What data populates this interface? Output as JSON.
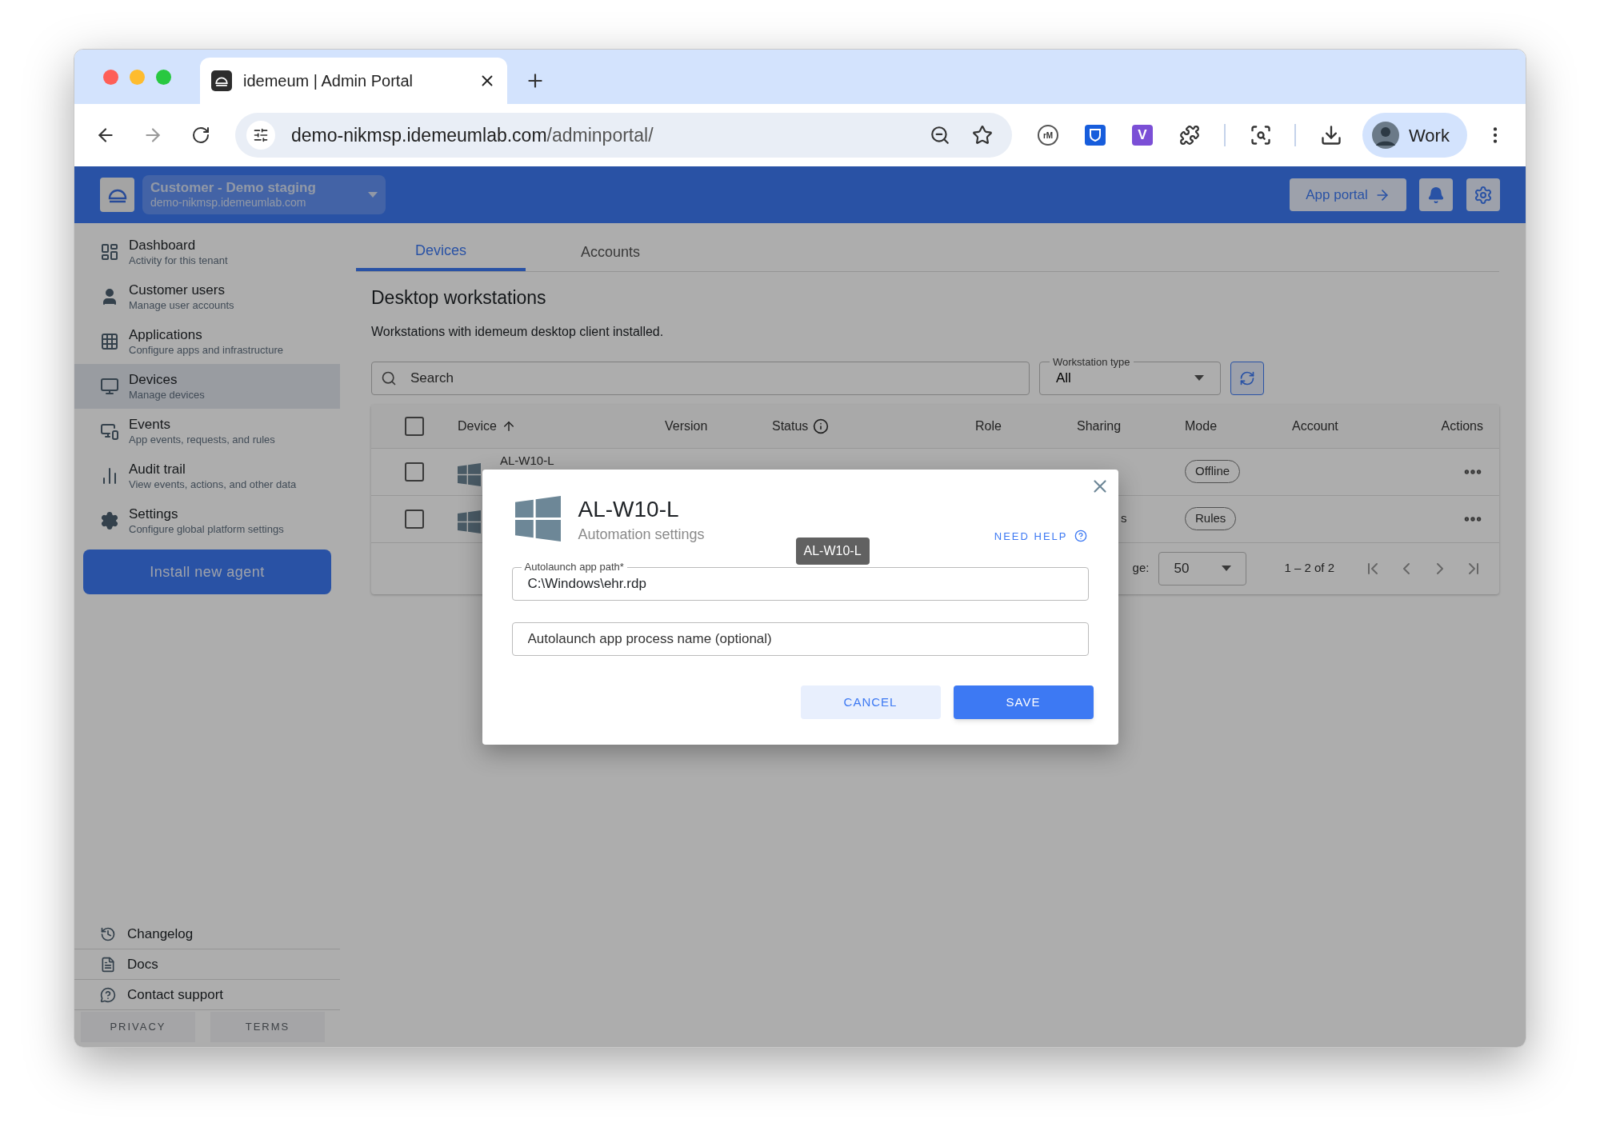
{
  "browser": {
    "tab_title": "idemeum | Admin Portal",
    "url_host": "demo-nikmsp.idemeumlab.com",
    "url_path": "/adminportal/",
    "profile": "Work",
    "extensions": [
      {
        "kind": "circle",
        "label": "rM"
      },
      {
        "kind": "shield"
      },
      {
        "kind": "letter",
        "label": "V"
      },
      {
        "kind": "puzzle"
      }
    ]
  },
  "header": {
    "tenant_name": "Customer - Demo staging",
    "tenant_domain": "demo-nikmsp.idemeumlab.com",
    "app_portal": "App portal"
  },
  "sidebar": {
    "items": [
      {
        "title": "Dashboard",
        "subtitle": "Activity for this tenant",
        "selected": false
      },
      {
        "title": "Customer users",
        "subtitle": "Manage user accounts",
        "selected": false
      },
      {
        "title": "Applications",
        "subtitle": "Configure apps and infrastructure",
        "selected": false
      },
      {
        "title": "Devices",
        "subtitle": "Manage devices",
        "selected": true
      },
      {
        "title": "Events",
        "subtitle": "App events, requests, and rules",
        "selected": false
      },
      {
        "title": "Audit trail",
        "subtitle": "View events, actions, and other data",
        "selected": false
      },
      {
        "title": "Settings",
        "subtitle": "Configure global platform settings",
        "selected": false
      }
    ],
    "install_button": "Install new agent",
    "footer_links": [
      "Changelog",
      "Docs",
      "Contact support"
    ],
    "legal": [
      "PRIVACY",
      "TERMS"
    ]
  },
  "tabs": [
    {
      "label": "Devices",
      "selected": true
    },
    {
      "label": "Accounts",
      "selected": false
    }
  ],
  "page": {
    "title": "Desktop workstations",
    "description": "Workstations with idemeum desktop client installed."
  },
  "search": {
    "placeholder": "Search"
  },
  "workstation_type": {
    "label": "Workstation type",
    "value": "All"
  },
  "table": {
    "all_checked": false,
    "columns": [
      {
        "label": "Device",
        "sorted": true,
        "hint": false
      },
      {
        "label": "Version",
        "sorted": false,
        "hint": false
      },
      {
        "label": "Status",
        "sorted": false,
        "hint": true
      },
      {
        "label": "Role",
        "sorted": false,
        "hint": false
      },
      {
        "label": "Sharing",
        "sorted": false,
        "hint": false
      },
      {
        "label": "Mode",
        "sorted": false,
        "hint": false
      },
      {
        "label": "Account",
        "sorted": false,
        "hint": false
      },
      {
        "label": "Actions",
        "sorted": false,
        "hint": false
      }
    ],
    "rows": [
      {
        "checked": false,
        "device": "AL-W10-L",
        "mode": "Offline"
      },
      {
        "checked": false,
        "sharing": "s",
        "mode": "Rules"
      }
    ],
    "pagination": {
      "label": "ge:",
      "per_page": "50",
      "range": "1 – 2 of 2"
    }
  },
  "dialog": {
    "title": "AL-W10-L",
    "subtitle": "Automation settings",
    "help": "NEED HELP",
    "tooltip": "AL-W10-L",
    "fields": [
      {
        "label": "Autolaunch app path*",
        "value": "C:\\Windows\\ehr.rdp"
      },
      {
        "placeholder": "Autolaunch app process name (optional)"
      }
    ],
    "buttons": [
      "CANCEL",
      "SAVE"
    ]
  }
}
